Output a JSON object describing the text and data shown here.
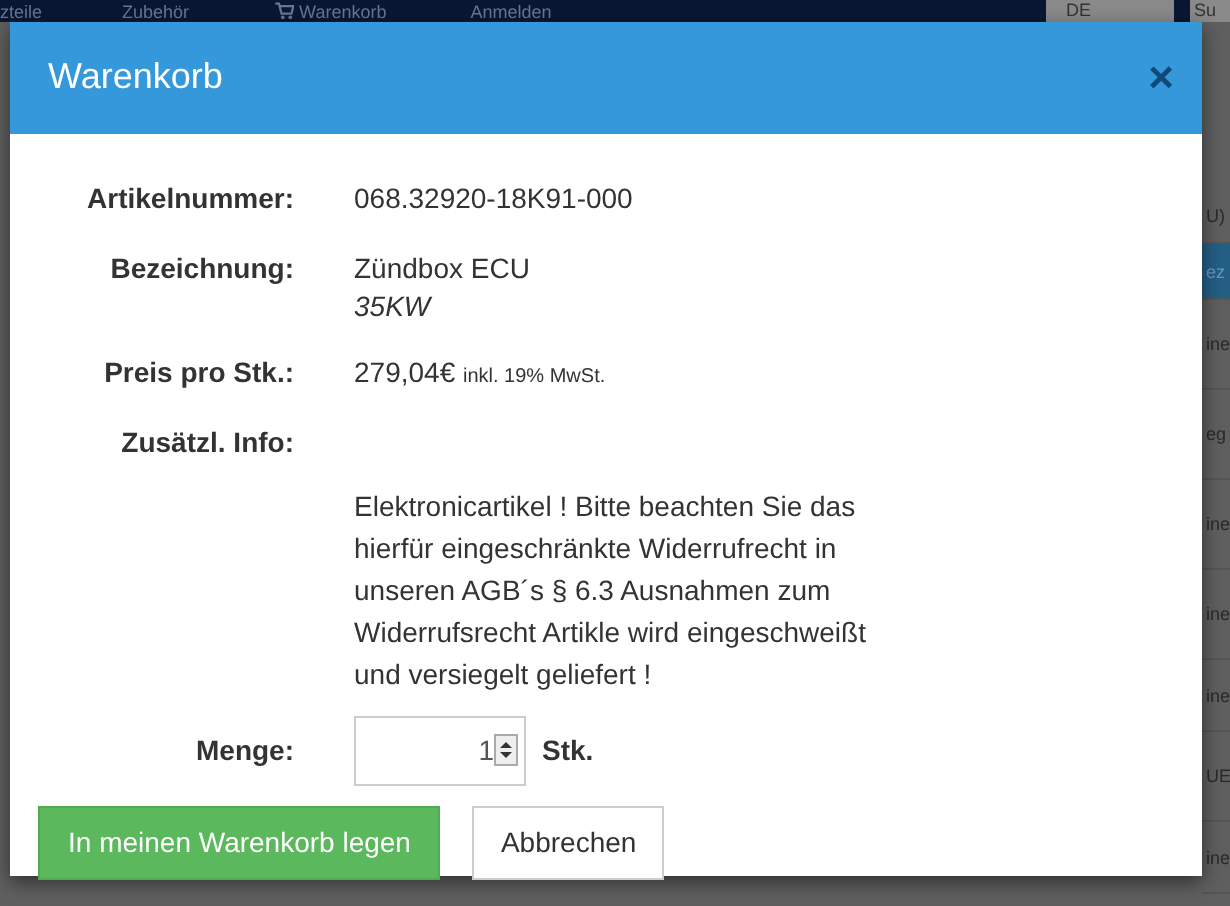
{
  "background_nav": {
    "items": [
      {
        "label": "zteile",
        "icon": false
      },
      {
        "label": "Zubehör",
        "icon": false
      },
      {
        "label": "Warenkorb",
        "icon": true
      },
      {
        "label": "Anmelden",
        "icon": false
      }
    ],
    "language": "DE",
    "search_button": "Su"
  },
  "background_right": [
    "U)",
    "ez",
    "ine",
    "eg",
    "ine",
    "ine",
    "ine",
    "UE",
    "ine"
  ],
  "modal": {
    "title": "Warenkorb",
    "close": "×",
    "fields": [
      {
        "label": "Artikelnummer:",
        "value": "068.32920-18K91-000"
      },
      {
        "label": "Bezeichnung:",
        "value": "Zündbox ECU",
        "note": "35KW"
      },
      {
        "label": "Preis pro Stk.:",
        "value": "279,04€",
        "note": "inkl. 19% MwSt."
      },
      {
        "label": "Zusätzl. Info:",
        "value": "Elektronicartikel ! Bitte beachten Sie das hierfür eingeschränkte Widerrufrecht in unseren AGB´s § 6.3 Ausnahmen zum Widerrufsrecht Artikle wird eingeschweißt und versiegelt geliefert !"
      }
    ],
    "quantity": {
      "label": "Menge:",
      "value": "1",
      "unit": "Stk."
    },
    "buttons": [
      {
        "label": "In meinen Warenkorb legen",
        "kind": "primary"
      },
      {
        "label": "Abbrechen",
        "kind": "secondary"
      }
    ]
  }
}
